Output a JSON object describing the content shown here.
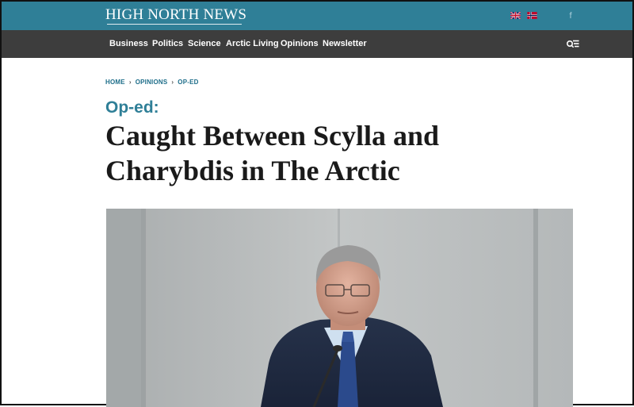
{
  "site": {
    "logo": "HIGH NORTH NEWS",
    "brand_color": "#2f7f97",
    "nav_bg": "#3d3d3d"
  },
  "header": {
    "languages": [
      {
        "icon": "uk-flag-icon"
      },
      {
        "icon": "norway-flag-icon"
      }
    ],
    "social": {
      "icon": "facebook-icon",
      "glyph": "f"
    }
  },
  "nav": {
    "items": [
      "Business",
      "Politics",
      "Science",
      "Arctic Living",
      "Opinions",
      "Newsletter"
    ],
    "menu_icon": "search-menu-icon"
  },
  "breadcrumb": {
    "items": [
      "HOME",
      "OPINIONS",
      "OP-ED"
    ],
    "separator": "›"
  },
  "article": {
    "kicker": "Op-ed:",
    "title": "Caught Between Scylla and Charybdis in The Arctic"
  }
}
